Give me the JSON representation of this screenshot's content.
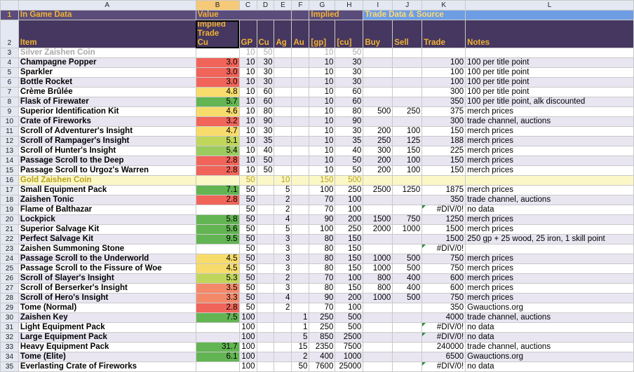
{
  "columns": [
    "A",
    "B",
    "C",
    "D",
    "E",
    "F",
    "G",
    "H",
    "I",
    "J",
    "K",
    "L"
  ],
  "header1": {
    "in_game": "In Game Data",
    "value": "Value",
    "implied": "Implied",
    "trade": "Trade Data & Source"
  },
  "header2": {
    "item": "Item",
    "implied_trade_cu": [
      "Implied",
      "Trade",
      "Cu"
    ],
    "gp": "GP",
    "cu": "Cu",
    "ag": "Ag",
    "au": "Au",
    "gp_b": "[gp]",
    "cu_b": "[cu]",
    "buy": "Buy",
    "sell": "Sell",
    "trade": "Trade",
    "notes": "Notes"
  },
  "rows": [
    {
      "n": "3",
      "item": "Silver Zaishen Coin",
      "b": "",
      "c": "10",
      "d": "50",
      "e": "",
      "f": "",
      "g": "10",
      "h": "50",
      "i": "",
      "j": "",
      "k": "",
      "l": "",
      "style": "silver"
    },
    {
      "n": "4",
      "item": "Champagne Popper",
      "b": "3.0",
      "c": "10",
      "d": "30",
      "e": "",
      "f": "",
      "g": "10",
      "h": "30",
      "i": "",
      "j": "",
      "k": "100",
      "l": "100 per title point",
      "color": "red"
    },
    {
      "n": "5",
      "item": "Sparkler",
      "b": "3.0",
      "c": "10",
      "d": "30",
      "e": "",
      "f": "",
      "g": "10",
      "h": "30",
      "i": "",
      "j": "",
      "k": "100",
      "l": "100 per title point",
      "color": "red"
    },
    {
      "n": "6",
      "item": "Bottle Rocket",
      "b": "3.0",
      "c": "10",
      "d": "30",
      "e": "",
      "f": "",
      "g": "10",
      "h": "30",
      "i": "",
      "j": "",
      "k": "100",
      "l": "100 per title point",
      "color": "red"
    },
    {
      "n": "7",
      "item": "Crème Brûlée",
      "b": "4.8",
      "c": "10",
      "d": "60",
      "e": "",
      "f": "",
      "g": "10",
      "h": "60",
      "i": "",
      "j": "",
      "k": "300",
      "l": "100 per title point",
      "color": "yel"
    },
    {
      "n": "8",
      "item": "Flask of Firewater",
      "b": "5.7",
      "c": "10",
      "d": "60",
      "e": "",
      "f": "",
      "g": "10",
      "h": "60",
      "i": "",
      "j": "",
      "k": "350",
      "l": "100 per title point, alk discounted",
      "color": "grn"
    },
    {
      "n": "9",
      "item": "Superior Identification Kit",
      "b": "4.6",
      "c": "10",
      "d": "80",
      "e": "",
      "f": "",
      "g": "10",
      "h": "80",
      "i": "500",
      "j": "250",
      "k": "375",
      "l": "merch prices",
      "color": "yel"
    },
    {
      "n": "10",
      "item": "Crate of Fireworks",
      "b": "3.2",
      "c": "10",
      "d": "90",
      "e": "",
      "f": "",
      "g": "10",
      "h": "90",
      "i": "",
      "j": "",
      "k": "300",
      "l": "trade channel, auctions",
      "color": "red"
    },
    {
      "n": "11",
      "item": "Scroll of Adventurer's Insight",
      "b": "4.7",
      "c": "10",
      "d": "30",
      "e": "",
      "f": "",
      "g": "10",
      "h": "30",
      "i": "200",
      "j": "100",
      "k": "150",
      "l": "merch prices",
      "color": "yel"
    },
    {
      "n": "12",
      "item": "Scroll of Rampager's Insight",
      "b": "5.1",
      "c": "10",
      "d": "35",
      "e": "",
      "f": "",
      "g": "10",
      "h": "35",
      "i": "250",
      "j": "125",
      "k": "188",
      "l": "merch prices",
      "color": "lime"
    },
    {
      "n": "13",
      "item": "Scroll of Hunter's Insight",
      "b": "5.4",
      "c": "10",
      "d": "40",
      "e": "",
      "f": "",
      "g": "10",
      "h": "40",
      "i": "300",
      "j": "150",
      "k": "225",
      "l": "merch prices",
      "color": "lg"
    },
    {
      "n": "14",
      "item": "Passage Scroll to the Deep",
      "b": "2.8",
      "c": "10",
      "d": "50",
      "e": "",
      "f": "",
      "g": "10",
      "h": "50",
      "i": "200",
      "j": "100",
      "k": "150",
      "l": "merch prices",
      "color": "red"
    },
    {
      "n": "15",
      "item": "Passage Scroll to Urgoz's Warren",
      "b": "2.8",
      "c": "10",
      "d": "50",
      "e": "",
      "f": "",
      "g": "10",
      "h": "50",
      "i": "200",
      "j": "100",
      "k": "150",
      "l": "merch prices",
      "color": "red"
    },
    {
      "n": "16",
      "item": "Gold Zaishen Coin",
      "b": "",
      "c": "50",
      "d": "",
      "e": "10",
      "f": "",
      "g": "150",
      "h": "500",
      "i": "",
      "j": "",
      "k": "",
      "l": "",
      "style": "gold"
    },
    {
      "n": "17",
      "item": "Small Equipment Pack",
      "b": "7.1",
      "c": "50",
      "d": "",
      "e": "5",
      "f": "",
      "g": "100",
      "h": "250",
      "i": "2500",
      "j": "1250",
      "k": "1875",
      "l": "merch prices",
      "color": "grn"
    },
    {
      "n": "18",
      "item": "Zaishen Tonic",
      "b": "2.8",
      "c": "50",
      "d": "",
      "e": "2",
      "f": "",
      "g": "70",
      "h": "100",
      "i": "",
      "j": "",
      "k": "350",
      "l": "trade channel, auctions",
      "color": "red"
    },
    {
      "n": "19",
      "item": "Flame of Balthazar",
      "b": "",
      "c": "50",
      "d": "",
      "e": "2",
      "f": "",
      "g": "70",
      "h": "100",
      "i": "",
      "j": "",
      "k": "#DIV/0!",
      "l": "no data",
      "kerr": true
    },
    {
      "n": "20",
      "item": "Lockpick",
      "b": "5.8",
      "c": "50",
      "d": "",
      "e": "4",
      "f": "",
      "g": "90",
      "h": "200",
      "i": "1500",
      "j": "750",
      "k": "1250",
      "l": "merch prices",
      "color": "grn"
    },
    {
      "n": "21",
      "item": "Superior Salvage Kit",
      "b": "5.6",
      "c": "50",
      "d": "",
      "e": "5",
      "f": "",
      "g": "100",
      "h": "250",
      "i": "2000",
      "j": "1000",
      "k": "1500",
      "l": "merch prices",
      "color": "grn"
    },
    {
      "n": "22",
      "item": "Perfect Salvage Kit",
      "b": "9.5",
      "c": "50",
      "d": "",
      "e": "3",
      "f": "",
      "g": "80",
      "h": "150",
      "i": "",
      "j": "",
      "k": "1500",
      "l": "250 gp + 25 wood, 25 iron, 1 skill point",
      "color": "grn"
    },
    {
      "n": "23",
      "item": "Zaishen Summoning Stone",
      "b": "",
      "c": "50",
      "d": "",
      "e": "3",
      "f": "",
      "g": "80",
      "h": "150",
      "i": "",
      "j": "",
      "k": "#DIV/0!",
      "l": "",
      "kerr": true
    },
    {
      "n": "24",
      "item": "Passage Scroll to the Underworld",
      "b": "4.5",
      "c": "50",
      "d": "",
      "e": "3",
      "f": "",
      "g": "80",
      "h": "150",
      "i": "1000",
      "j": "500",
      "k": "750",
      "l": "merch prices",
      "color": "yel"
    },
    {
      "n": "25",
      "item": "Passage Scroll to the Fissure of Woe",
      "b": "4.5",
      "c": "50",
      "d": "",
      "e": "3",
      "f": "",
      "g": "80",
      "h": "150",
      "i": "1000",
      "j": "500",
      "k": "750",
      "l": "merch prices",
      "color": "yel"
    },
    {
      "n": "26",
      "item": "Scroll of Slayer's Insight",
      "b": "5.3",
      "c": "50",
      "d": "",
      "e": "2",
      "f": "",
      "g": "70",
      "h": "100",
      "i": "800",
      "j": "400",
      "k": "600",
      "l": "merch prices",
      "color": "lime"
    },
    {
      "n": "27",
      "item": "Scroll of Berserker's Insight",
      "b": "3.5",
      "c": "50",
      "d": "",
      "e": "3",
      "f": "",
      "g": "80",
      "h": "150",
      "i": "800",
      "j": "400",
      "k": "600",
      "l": "merch prices",
      "color": "salmon"
    },
    {
      "n": "28",
      "item": "Scroll of Hero's Insight",
      "b": "3.3",
      "c": "50",
      "d": "",
      "e": "4",
      "f": "",
      "g": "90",
      "h": "200",
      "i": "1000",
      "j": "500",
      "k": "750",
      "l": "merch prices",
      "color": "salmon"
    },
    {
      "n": "29",
      "item": "Tome (Normal)",
      "b": "2.8",
      "c": "50",
      "d": "",
      "e": "2",
      "f": "",
      "g": "70",
      "h": "100",
      "i": "",
      "j": "",
      "k": "350",
      "l": "Gwauctions.org",
      "color": "red"
    },
    {
      "n": "30",
      "item": "Zaishen Key",
      "b": "7.5",
      "c": "100",
      "d": "",
      "e": "",
      "f": "1",
      "g": "250",
      "h": "500",
      "i": "",
      "j": "",
      "k": "4000",
      "l": "trade channel, auctions",
      "color": "grn"
    },
    {
      "n": "31",
      "item": "Light Equipment Pack",
      "b": "",
      "c": "100",
      "d": "",
      "e": "",
      "f": "1",
      "g": "250",
      "h": "500",
      "i": "",
      "j": "",
      "k": "#DIV/0!",
      "l": "no data",
      "kerr": true
    },
    {
      "n": "32",
      "item": "Large Equipment Pack",
      "b": "",
      "c": "100",
      "d": "",
      "e": "",
      "f": "5",
      "g": "850",
      "h": "2500",
      "i": "",
      "j": "",
      "k": "#DIV/0!",
      "l": "no data",
      "kerr": true
    },
    {
      "n": "33",
      "item": "Heavy Equipment Pack",
      "b": "31.7",
      "c": "100",
      "d": "",
      "e": "",
      "f": "15",
      "g": "2350",
      "h": "7500",
      "i": "",
      "j": "",
      "k": "240000",
      "l": "trade channel, auctions",
      "color": "grn"
    },
    {
      "n": "34",
      "item": "Tome (Elite)",
      "b": "6.1",
      "c": "100",
      "d": "",
      "e": "",
      "f": "2",
      "g": "400",
      "h": "1000",
      "i": "",
      "j": "",
      "k": "6500",
      "l": "Gwauctions.org",
      "color": "grn"
    },
    {
      "n": "35",
      "item": "Everlasting Crate of Fireworks",
      "b": "",
      "c": "100",
      "d": "",
      "e": "",
      "f": "50",
      "g": "7600",
      "h": "25000",
      "i": "",
      "j": "",
      "k": "#DIV/0!",
      "l": "no data",
      "kerr": true
    }
  ]
}
